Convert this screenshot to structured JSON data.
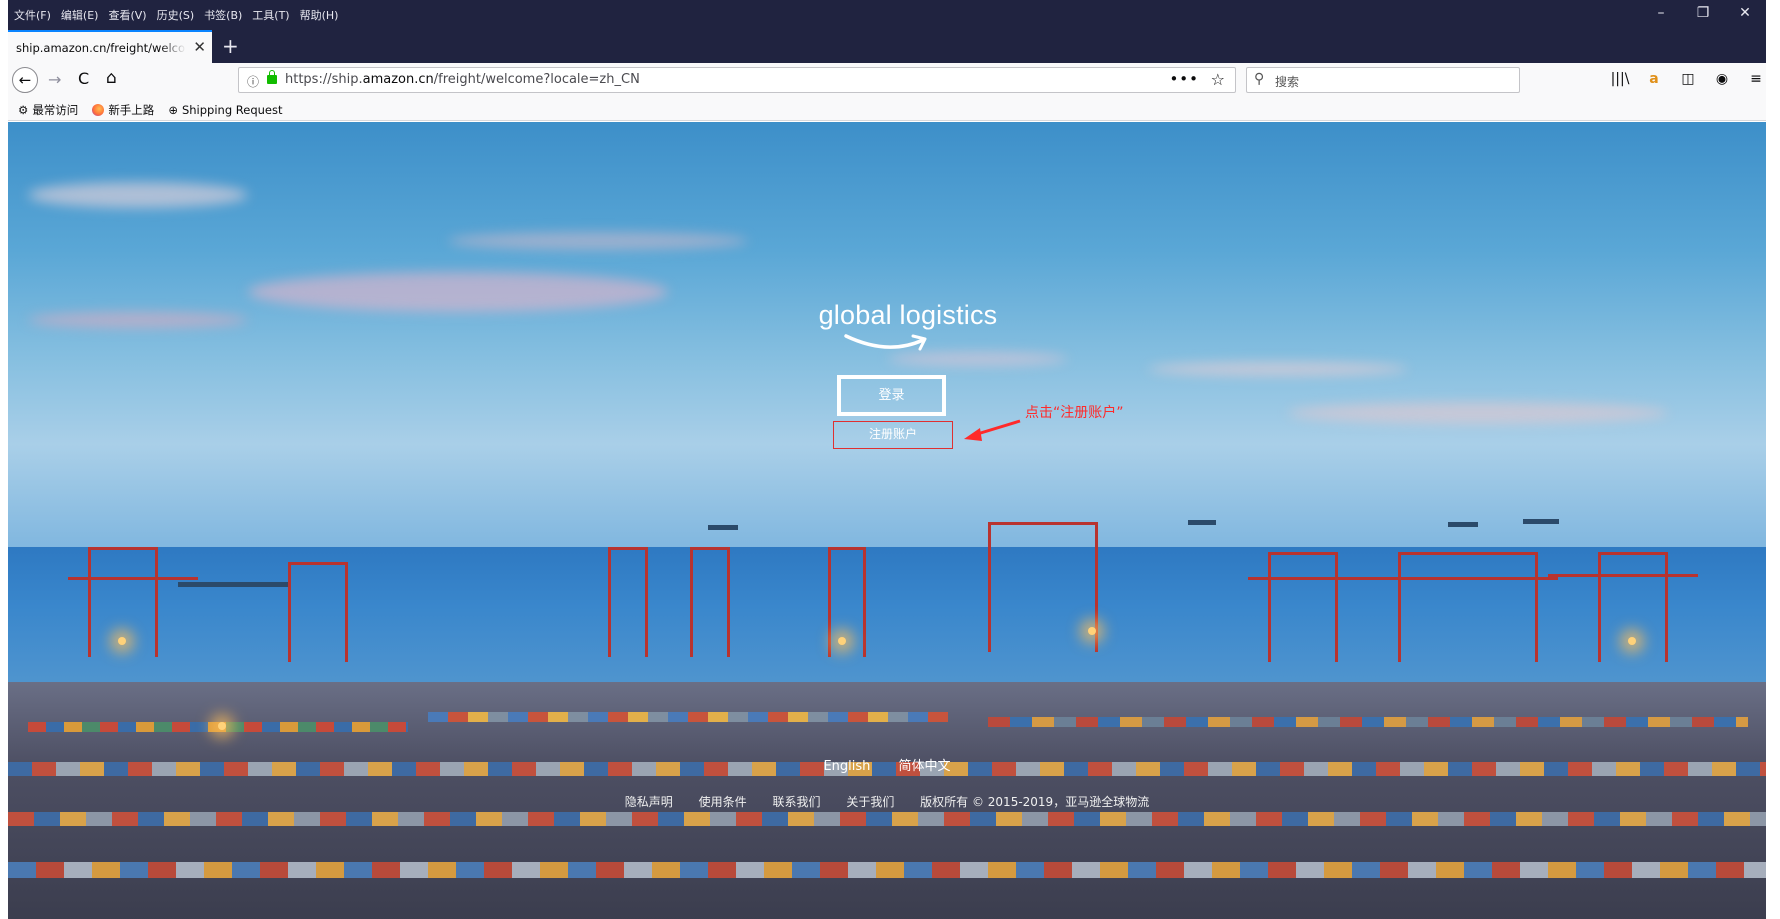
{
  "menu": [
    "文件(F)",
    "编辑(E)",
    "查看(V)",
    "历史(S)",
    "书签(B)",
    "工具(T)",
    "帮助(H)"
  ],
  "window_controls": {
    "minimize": "–",
    "restore": "❐",
    "close": "✕"
  },
  "tab": {
    "title": "ship.amazon.cn/freight/welcome",
    "close": "✕",
    "new_tab": "+"
  },
  "nav": {
    "back": "←",
    "forward": "→",
    "reload": "C",
    "home": "⌂",
    "info_icon": "ⓘ",
    "url_prefix": "https://ship.",
    "url_domain": "amazon.cn",
    "url_path": "/freight/welcome?locale=zh_CN",
    "more": "•••",
    "star": "☆"
  },
  "search": {
    "icon": "🔍",
    "placeholder": "搜索"
  },
  "toolbar_icons": [
    "library-icon",
    "amazon-extension-icon",
    "sidebar-icon",
    "account-icon",
    "menu-icon"
  ],
  "toolbar_glyphs": [
    "|||\\",
    "a",
    "◫",
    "◉",
    "≡"
  ],
  "bookmarks": [
    {
      "icon": "gear-icon",
      "glyph": "⚙",
      "label": "最常访问"
    },
    {
      "icon": "firefox-icon",
      "glyph": "",
      "label": "新手上路"
    },
    {
      "icon": "globe-icon",
      "glyph": "⊕",
      "label": "Shipping Request"
    }
  ],
  "page": {
    "logo_text": "global logistics",
    "login_label": "登录",
    "register_label": "注册账户",
    "annotation": "点击“注册账户”",
    "annotation_color": "#ff2a2a",
    "languages": [
      "English",
      "简体中文"
    ],
    "footer_links": [
      "隐私声明",
      "使用条件",
      "联系我们",
      "关于我们",
      "版权所有 © 2015-2019，亚马逊全球物流"
    ]
  },
  "colors": {
    "chrome_dark": "#202340",
    "accent": "#0a84ff",
    "lock": "#12bc00",
    "register_border": "#e03030"
  }
}
